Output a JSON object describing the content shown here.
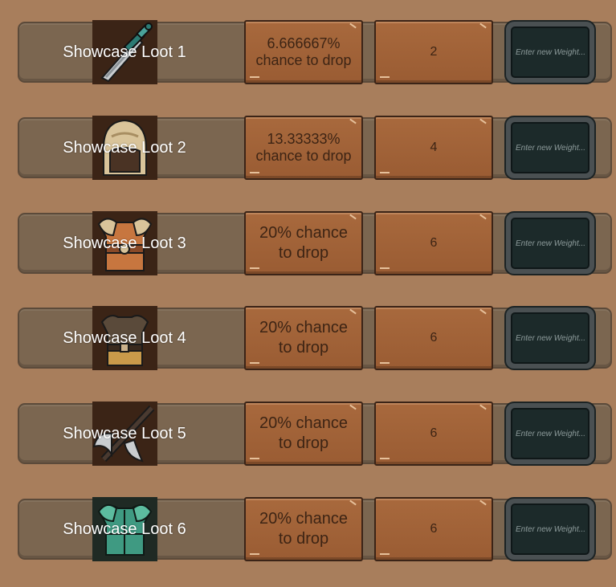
{
  "placeholder": "Enter new Weight...",
  "rows": [
    {
      "name": "Showcase Loot 1",
      "chance": "6.666667% chance to drop",
      "weight": "2",
      "icon": "sword-icon"
    },
    {
      "name": "Showcase Loot 2",
      "chance": "13.33333% chance to drop",
      "weight": "4",
      "icon": "helmet-icon"
    },
    {
      "name": "Showcase Loot 3",
      "chance": "20% chance to drop",
      "weight": "6",
      "icon": "armor-icon"
    },
    {
      "name": "Showcase Loot 4",
      "chance": "20% chance to drop",
      "weight": "6",
      "icon": "vest-icon"
    },
    {
      "name": "Showcase Loot 5",
      "chance": "20% chance to drop",
      "weight": "6",
      "icon": "axe-icon"
    },
    {
      "name": "Showcase Loot 6",
      "chance": "20% chance to drop",
      "weight": "6",
      "icon": "jade-armor-icon"
    }
  ]
}
